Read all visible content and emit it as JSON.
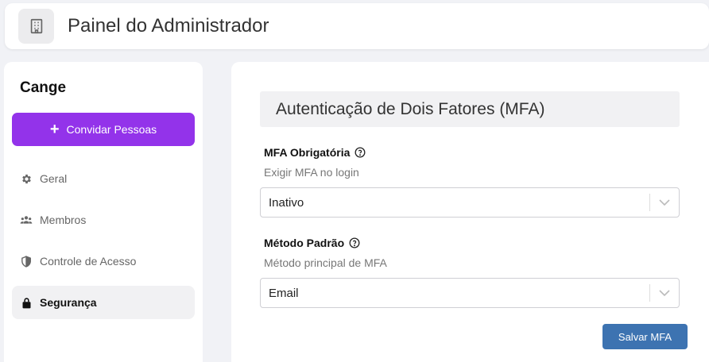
{
  "header": {
    "title": "Painel do Administrador",
    "logo_icon": "building-icon"
  },
  "sidebar": {
    "org_name": "Cange",
    "invite_label": "Convidar Pessoas",
    "accent_color": "#9333ea",
    "items": [
      {
        "label": "Geral",
        "icon": "gear-icon"
      },
      {
        "label": "Membros",
        "icon": "users-icon"
      },
      {
        "label": "Controle de Acesso",
        "icon": "shield-icon"
      },
      {
        "label": "Segurança",
        "icon": "lock-icon",
        "active": true
      }
    ]
  },
  "main": {
    "section_title": "Autenticação de Dois Fatores (MFA)",
    "fields": [
      {
        "label": "MFA Obrigatória",
        "help": "Exigir MFA no login",
        "value": "Inativo"
      },
      {
        "label": "Método Padrão",
        "help": "Método principal de MFA",
        "value": "Email"
      }
    ],
    "save_label": "Salvar MFA",
    "save_color": "#3d73b1"
  }
}
